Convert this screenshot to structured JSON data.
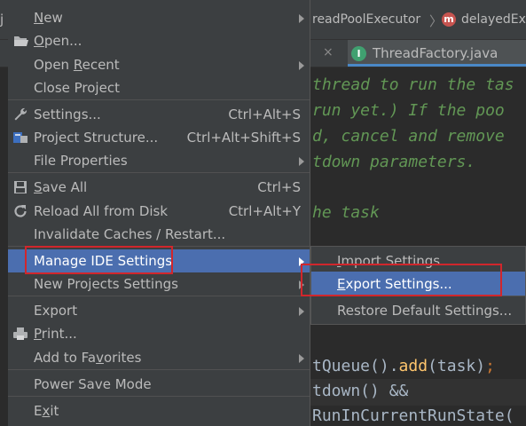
{
  "editor": {
    "breadcrumb_left": "readPoolExecutor",
    "breadcrumb_sep": "〉",
    "breadcrumb_right": "delayedEx",
    "method_icon": "m",
    "tab_close": "×",
    "tab_icon": "I",
    "tab_label": "ThreadFactory.java",
    "left_glyph": "j",
    "code_lines": [
      {
        "text": "thread to run the tas",
        "style": "comment"
      },
      {
        "text": "run yet.)  If the poo",
        "style": "comment"
      },
      {
        "text": "d, cancel and remove ",
        "style": "comment"
      },
      {
        "text": "tdown parameters.",
        "style": "comment"
      },
      {
        "text": "he task",
        "style": "comment"
      },
      {
        "text": ");",
        "style": "plain"
      },
      {
        "text": "tQueue().add(task);",
        "style": "mixed_add"
      },
      {
        "text": "tdown() &&",
        "style": "mixed_and"
      },
      {
        "text": "RunInCurrentRunState(",
        "style": "plain"
      }
    ]
  },
  "menu": {
    "items": [
      {
        "label": "New",
        "mnemonic_index": 0,
        "arrow": true,
        "icon": ""
      },
      {
        "label": "Open...",
        "mnemonic_index": 0,
        "icon": "folder-icon"
      },
      {
        "label": "Open Recent",
        "mnemonic_index": 5,
        "arrow": true,
        "icon": ""
      },
      {
        "label": "Close Project",
        "icon": ""
      },
      {
        "label": "Settings...",
        "shortcut": "Ctrl+Alt+S",
        "icon": "wrench-icon"
      },
      {
        "label": "Project Structure...",
        "shortcut": "Ctrl+Alt+Shift+S",
        "icon": "project-structure-icon"
      },
      {
        "label": "File Properties",
        "arrow": true,
        "icon": ""
      },
      {
        "label": "Save All",
        "mnemonic_index": 0,
        "shortcut": "Ctrl+S",
        "icon": "save-icon"
      },
      {
        "label": "Reload All from Disk",
        "shortcut": "Ctrl+Alt+Y",
        "icon": "reload-icon"
      },
      {
        "label": "Invalidate Caches / Restart...",
        "icon": ""
      },
      {
        "label": "Manage IDE Settings",
        "arrow": true,
        "selected": true,
        "icon": ""
      },
      {
        "label": "New Projects Settings",
        "arrow": true,
        "icon": ""
      },
      {
        "label": "Export",
        "arrow": true,
        "icon": ""
      },
      {
        "label": "Print...",
        "mnemonic_index": 0,
        "icon": "print-icon"
      },
      {
        "label": "Add to Favorites",
        "mnemonic_index": 9,
        "arrow": true,
        "icon": ""
      },
      {
        "label": "Power Save Mode",
        "icon": ""
      },
      {
        "label": "Exit",
        "mnemonic_index": 1,
        "icon": ""
      }
    ]
  },
  "submenu": {
    "items": [
      {
        "label": "Import Settings...",
        "mnemonic_index": 0
      },
      {
        "label": "Export Settings...",
        "mnemonic_index": 0,
        "selected": true
      },
      {
        "label": "Restore Default Settings..."
      }
    ]
  },
  "colors": {
    "menu_bg": "#3c3f41",
    "selection": "#4b6eaf",
    "highlight_box": "#d1262c",
    "comment": "#629755",
    "editor_bg": "#2b2b2b"
  }
}
